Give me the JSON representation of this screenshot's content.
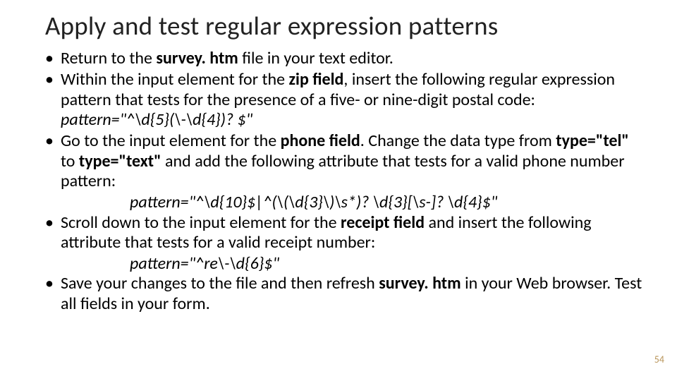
{
  "title": "Apply and test regular expression patterns",
  "bullets": {
    "b1_pre": "Return to the ",
    "b1_bold": "survey. htm",
    "b1_post": " file in your text editor.",
    "b2_pre": "Within the input element for the ",
    "b2_bold": "zip field",
    "b2_mid": ", insert the following regular expression pattern that tests for the presence of a five- or nine-digit postal code: ",
    "b2_code": "pattern=\"^\\d{5}(\\-\\d{4})? $\"",
    "b3_pre": "Go to the input element for the ",
    "b3_bold1": "phone field",
    "b3_mid1": ". Change the data type from ",
    "b3_bold2": "type=\"tel\"",
    "b3_mid2": " to ",
    "b3_bold3": "type=\"text\"",
    "b3_post": " and add the following attribute that tests for a valid phone number pattern:",
    "b3_code": "pattern=\"^\\d{10}$|^(\\(\\d{3}\\)\\s*)? \\d{3}[\\s-]? \\d{4}$\"",
    "b4_pre": "Scroll down to the input element for the ",
    "b4_bold": "receipt field",
    "b4_post": " and insert the following attribute that tests for a valid receipt number:",
    "b4_code": "pattern=\"^re\\-\\d{6}$\"",
    "b5_pre": "Save your changes to the file and then refresh ",
    "b5_bold": "survey. htm",
    "b5_post": " in your Web browser. Test all fields in your form."
  },
  "pageNumber": "54"
}
